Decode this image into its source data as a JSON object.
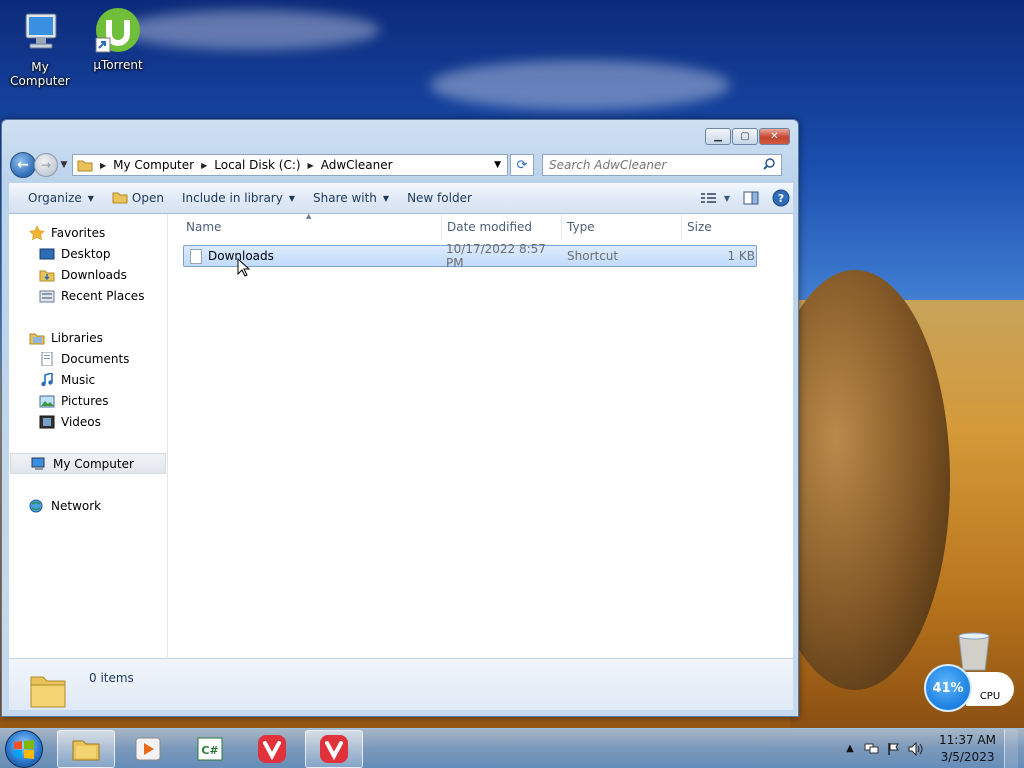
{
  "desktop": {
    "icons": [
      {
        "label": "My Computer"
      },
      {
        "label": "µTorrent"
      }
    ]
  },
  "window": {
    "address": {
      "segments": [
        "My Computer",
        "Local Disk (C:)",
        "AdwCleaner"
      ]
    },
    "search": {
      "placeholder": "Search AdwCleaner"
    },
    "toolbar": {
      "organize": "Organize",
      "open": "Open",
      "include_in_library": "Include in library",
      "share_with": "Share with",
      "new_folder": "New folder"
    },
    "nav_pane": {
      "favorites": "Favorites",
      "desktop": "Desktop",
      "downloads": "Downloads",
      "recent_places": "Recent Places",
      "libraries": "Libraries",
      "documents": "Documents",
      "music": "Music",
      "pictures": "Pictures",
      "videos": "Videos",
      "my_computer": "My Computer",
      "network": "Network"
    },
    "columns": {
      "name": "Name",
      "date_modified": "Date modified",
      "type": "Type",
      "size": "Size"
    },
    "files": [
      {
        "name": "Downloads",
        "date": "10/17/2022 8:57 PM",
        "type": "Shortcut",
        "size": "1 KB"
      }
    ],
    "status": {
      "count": "0 items"
    }
  },
  "taskbar": {
    "clock_time": "11:37 AM",
    "clock_date": "3/5/2023"
  },
  "cpu_gadget": {
    "percent": "41%",
    "label": "CPU"
  },
  "colors": {
    "accent": "#2d6cb6",
    "selection": "#c1dbfc"
  }
}
